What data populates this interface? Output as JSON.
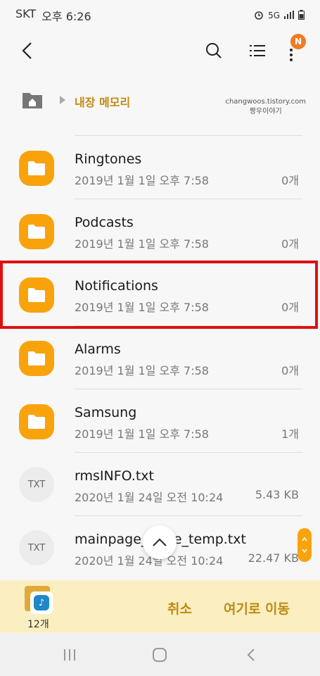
{
  "status_bar": {
    "carrier": "SKT",
    "time": "오후 6:26",
    "network": "5G"
  },
  "app_bar": {
    "notification_badge": "N",
    "accent_color": "#f07b22"
  },
  "breadcrumb": {
    "location": "내장 메모리"
  },
  "watermark": {
    "line1": "changwoos.tistory.com",
    "line2": "짱우이야기"
  },
  "files": [
    {
      "name": "Ringtones",
      "date": "2019년 1월 1일 오후 7:58",
      "size": "0개",
      "type": "folder"
    },
    {
      "name": "Podcasts",
      "date": "2019년 1월 1일 오후 7:58",
      "size": "0개",
      "type": "folder"
    },
    {
      "name": "Notifications",
      "date": "2019년 1월 1일 오후 7:58",
      "size": "0개",
      "type": "folder"
    },
    {
      "name": "Alarms",
      "date": "2019년 1월 1일 오후 7:58",
      "size": "0개",
      "type": "folder"
    },
    {
      "name": "Samsung",
      "date": "2019년 1월 1일 오후 7:58",
      "size": "1개",
      "type": "folder"
    },
    {
      "name": "rmsINFO.txt",
      "date": "2020년 1월 24일 오전 10:24",
      "size": "5.43 KB",
      "type": "txt"
    },
    {
      "name": "mainpage_state_temp.txt",
      "date": "2020년 1월 24일 오전 10:24",
      "size": "22.47 KB",
      "type": "txt"
    }
  ],
  "txt_icon_label": "TXT",
  "action_bar": {
    "clipboard_count": "12개",
    "cancel_label": "취소",
    "move_label": "여기로 이동",
    "clipboard_icon": "music-note-icon"
  },
  "colors": {
    "folder": "#f9a30c",
    "highlight": "#e01010",
    "accent_text": "#c08a12",
    "action_bar_bg": "#fbefc2"
  }
}
